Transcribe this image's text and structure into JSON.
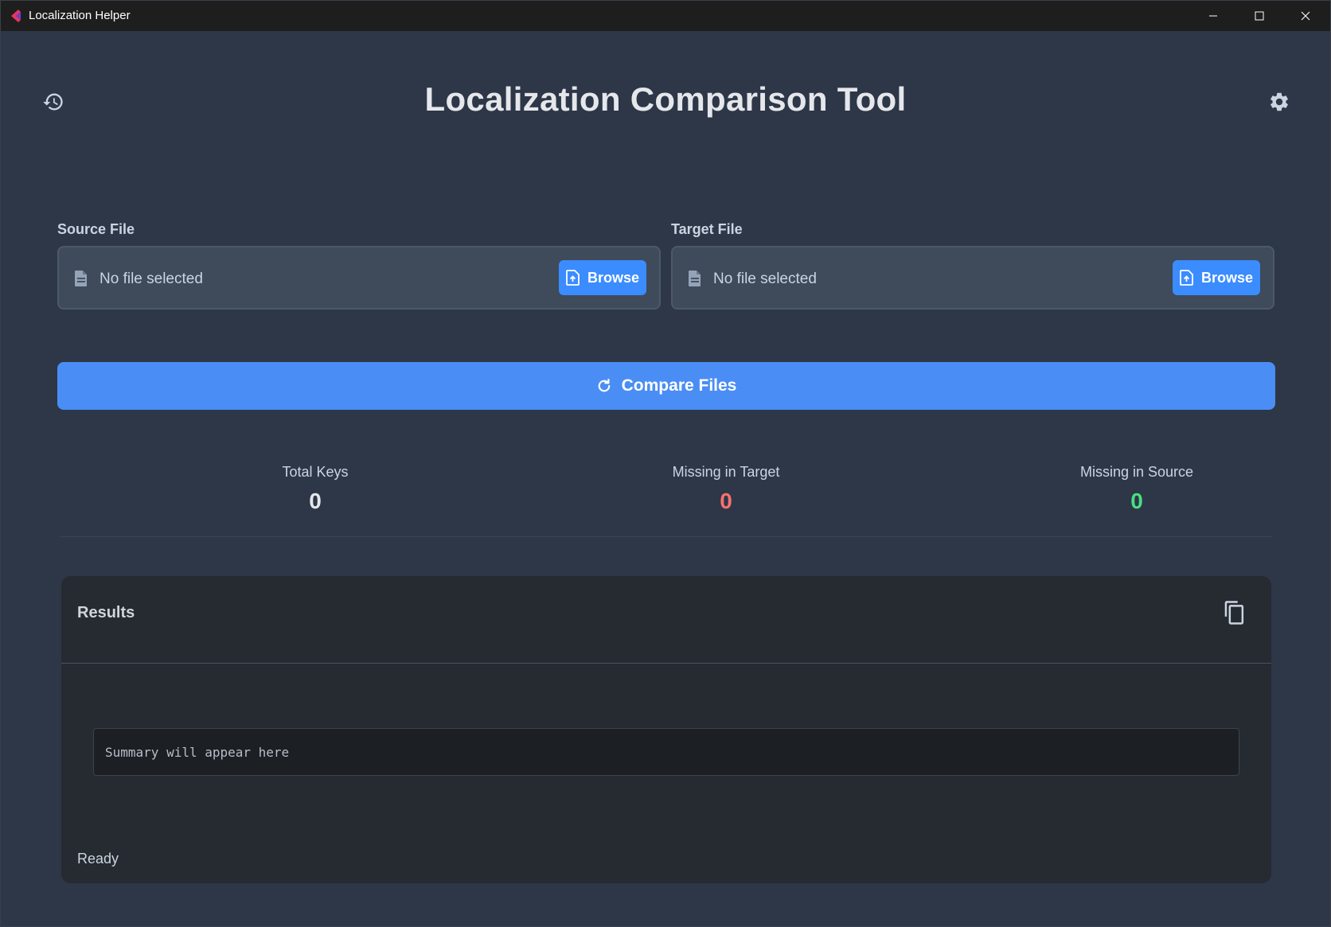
{
  "window": {
    "title": "Localization Helper"
  },
  "header": {
    "title": "Localization Comparison Tool",
    "left_icon": "history-icon",
    "right_icon": "gear-icon"
  },
  "source": {
    "label": "Source File",
    "file_text": "No file selected",
    "browse_label": "Browse"
  },
  "target": {
    "label": "Target File",
    "file_text": "No file selected",
    "browse_label": "Browse"
  },
  "compare": {
    "label": "Compare Files",
    "icon": "refresh-icon"
  },
  "stats": {
    "total_keys": {
      "label": "Total Keys",
      "value": "0",
      "color": "#e5e7eb"
    },
    "missing_in_target": {
      "label": "Missing in Target",
      "value": "0",
      "color": "#f87171"
    },
    "missing_in_source": {
      "label": "Missing in Source",
      "value": "0",
      "color": "#4ade80"
    }
  },
  "results": {
    "title": "Results",
    "summary_placeholder": "Summary will appear here",
    "status": "Ready"
  },
  "colors": {
    "accent": "#3b8cff",
    "background": "#2d3748",
    "panel": "#262a31"
  }
}
